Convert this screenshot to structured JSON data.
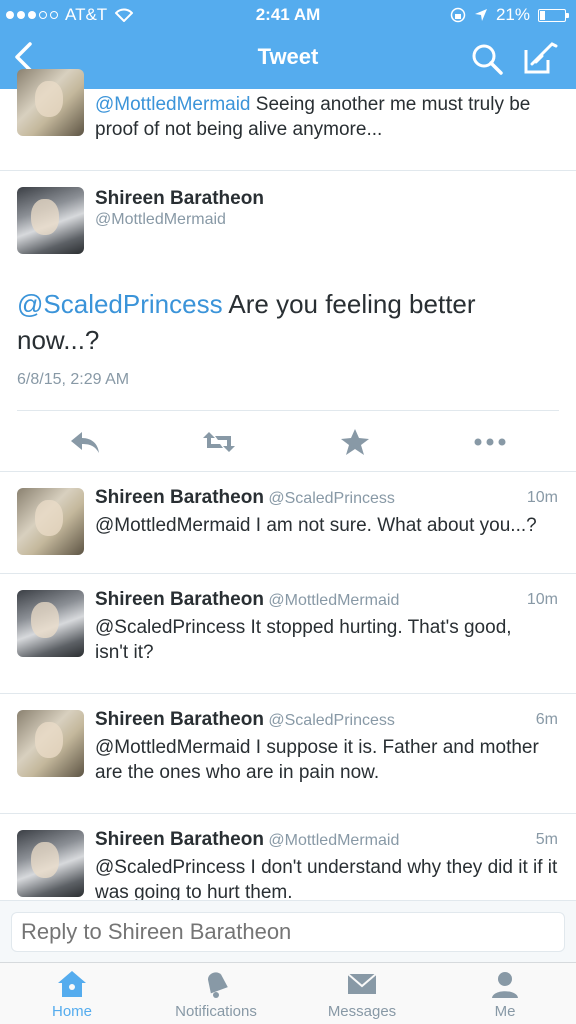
{
  "status": {
    "carrier": "AT&T",
    "time": "2:41 AM",
    "battery": "21%",
    "battery_level": 0.21
  },
  "nav": {
    "title": "Tweet"
  },
  "prev_tweet": {
    "text_mention": "@MottledMermaid",
    "text": " Seeing another me must truly be proof of not being alive anymore..."
  },
  "main_tweet": {
    "name": "Shireen Baratheon",
    "handle": "@MottledMermaid",
    "mention": "@ScaledPrincess",
    "text": " Are you feeling better now...?",
    "timestamp": "6/8/15, 2:29 AM"
  },
  "replies": [
    {
      "name": "Shireen Baratheon",
      "handle": "@ScaledPrincess",
      "age": "10m",
      "mention": "@MottledMermaid",
      "text": " I am not sure. What about you...?"
    },
    {
      "name": "Shireen Baratheon",
      "handle": "@MottledMermaid",
      "age": "10m",
      "mention": "@ScaledPrincess",
      "text": " It stopped hurting. That's good, isn't it?"
    },
    {
      "name": "Shireen Baratheon",
      "handle": "@ScaledPrincess",
      "age": "6m",
      "mention": "@MottledMermaid",
      "text": " I suppose it is. Father and mother are the ones who are in pain now."
    },
    {
      "name": "Shireen Baratheon",
      "handle": "@MottledMermaid",
      "age": "5m",
      "mention": "@ScaledPrincess",
      "text": " I don't understand why they did it if it was going to hurt them."
    }
  ],
  "reply_box": {
    "placeholder": "Reply to Shireen Baratheon"
  },
  "tabs": [
    {
      "label": "Home",
      "icon": "home-icon",
      "active": true
    },
    {
      "label": "Notifications",
      "icon": "bell-icon",
      "active": false
    },
    {
      "label": "Messages",
      "icon": "envelope-icon",
      "active": false
    },
    {
      "label": "Me",
      "icon": "person-icon",
      "active": false
    }
  ],
  "colors": {
    "brand": "#55acee",
    "link": "#3b94d9",
    "muted": "#8899a6",
    "text": "#292f33"
  }
}
